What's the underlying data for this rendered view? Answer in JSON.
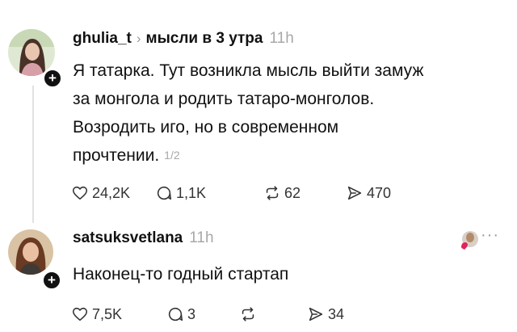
{
  "posts": [
    {
      "username": "ghulia_t",
      "chevron": "›",
      "topic": "мысли в 3 утра",
      "time": "11h",
      "lines": [
        "Я татарка. Тут возникла мысль выйти замуж",
        "за монгола и родить татаро-монголов.",
        "Возродить иго, но в современном",
        "прочтении."
      ],
      "page_indicator": "1/2",
      "likes": "24,2K",
      "replies": "1,1K",
      "reposts": "62",
      "shares": "470",
      "follow_badge": "+"
    },
    {
      "username": "satsuksvetlana",
      "time": "11h",
      "text": "Наконец-то годный стартап",
      "likes": "7,5K",
      "replies": "3",
      "reposts": "",
      "shares": "34",
      "follow_badge": "+",
      "more": "···"
    }
  ],
  "icons": {
    "like": "heart-icon",
    "reply": "comment-icon",
    "repost": "repost-icon",
    "share": "send-icon"
  }
}
